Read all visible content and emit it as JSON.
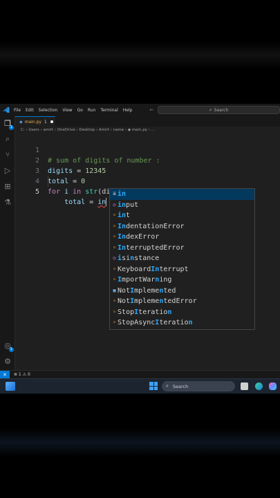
{
  "window": {
    "menu": [
      "File",
      "Edit",
      "Selection",
      "View",
      "Go",
      "Run",
      "Terminal",
      "Help"
    ],
    "nav_arrows": "← →",
    "search_label": "Search"
  },
  "tab": {
    "filename": "main.py",
    "problems": "1"
  },
  "breadcrumb": "C: › Users › amirt › OneDrive › Desktop › Amirt › name › ◆ main.py › ...",
  "editor": {
    "lines": [
      {
        "n": "1",
        "comment": "# sum of digits of number :"
      },
      {
        "n": "2",
        "var": "digits",
        "op": " = ",
        "num": "12345"
      },
      {
        "n": "3",
        "var": "total",
        "op": " = ",
        "num": "0"
      },
      {
        "n": "4",
        "kw1": "for",
        "v": " i ",
        "kw2": "in",
        "fn": " str",
        "rest": "(digits):"
      },
      {
        "n": "5",
        "indent": "    ",
        "var": "total",
        "op": " = ",
        "typed": "in"
      }
    ]
  },
  "suggestions": [
    {
      "kind": "kw",
      "icon": "≣",
      "match": "in",
      "rest": "",
      "selected": true
    },
    {
      "kind": "fn",
      "icon": "◎",
      "match": "in",
      "rest": "put"
    },
    {
      "kind": "cls",
      "icon": "⸰",
      "match": "in",
      "rest": "t"
    },
    {
      "kind": "cls",
      "icon": "⸰",
      "label": "IndentationError"
    },
    {
      "kind": "cls",
      "icon": "⸰",
      "label": "IndexError"
    },
    {
      "kind": "cls",
      "icon": "⸰",
      "label": "InterruptedError"
    },
    {
      "kind": "fn",
      "icon": "◎",
      "label": "isinstance"
    },
    {
      "kind": "cls",
      "icon": "⸰",
      "label": "KeyboardInterrupt"
    },
    {
      "kind": "cls",
      "icon": "⸰",
      "label": "ImportWarning"
    },
    {
      "kind": "const",
      "icon": "▣",
      "label": "NotImplemented"
    },
    {
      "kind": "cls",
      "icon": "⸰",
      "label": "NotImplementedError"
    },
    {
      "kind": "cls",
      "icon": "⸰",
      "label": "StopIteration"
    },
    {
      "kind": "cls",
      "icon": "⸰",
      "label": "StopAsyncIteration"
    }
  ],
  "status": {
    "remote_icon": "✕",
    "problems": "⊗ 1 ⚠ 0"
  },
  "taskbar": {
    "search_label": "Search"
  },
  "colors": {
    "accent": "#0078d4",
    "match": "#2aaaff",
    "selected_row": "#04395e"
  }
}
